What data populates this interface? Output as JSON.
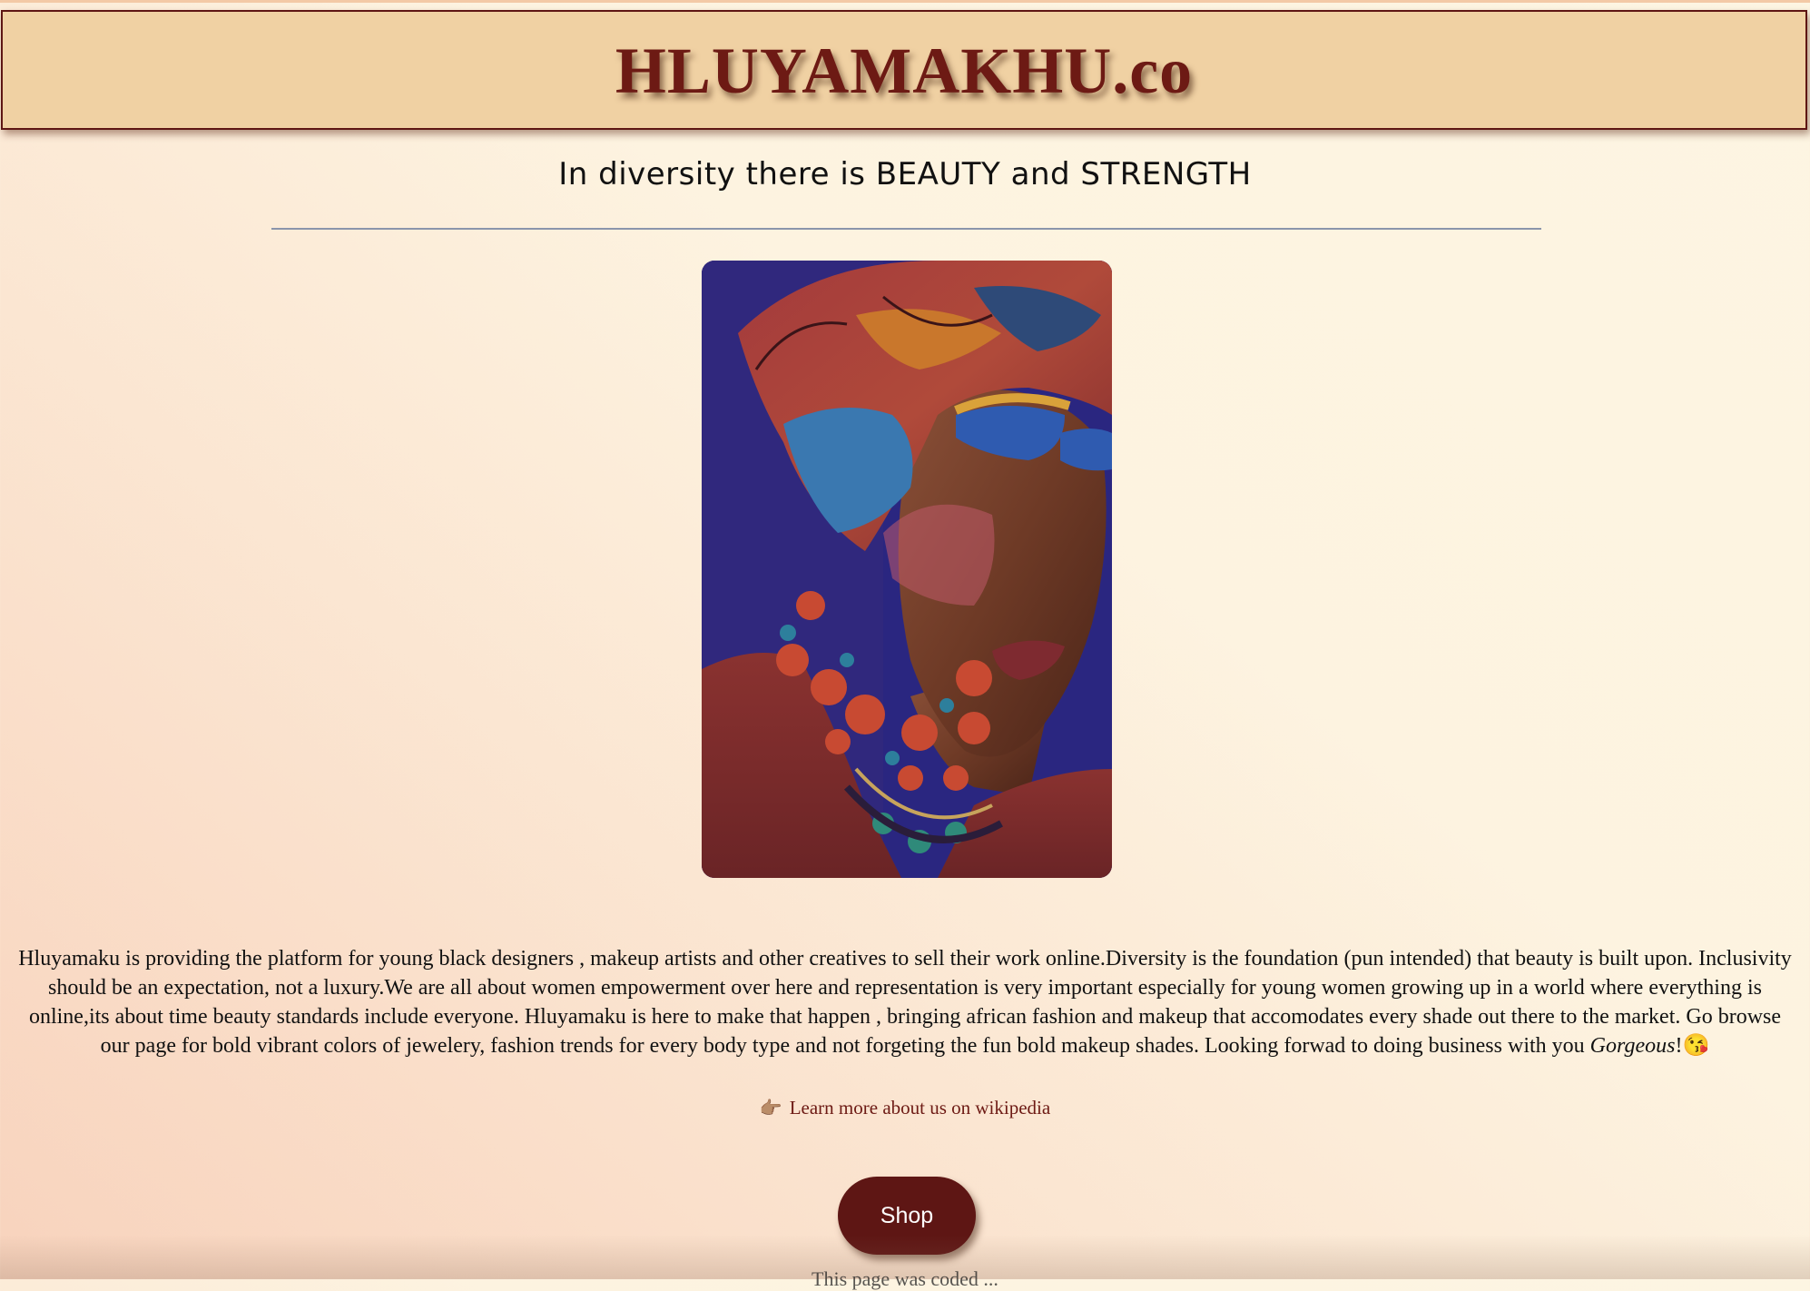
{
  "header": {
    "brand": "HLUYAMAKHU.co",
    "tagline": "In diversity there is BEAUTY and STRENGTH"
  },
  "hero": {
    "image_icon": "portrait-photo"
  },
  "about": {
    "text": "Hluyamaku is providing the platform for young black designers , makeup artists and other creatives to sell their work online.Diversity is the foundation (pun intended) that beauty is built upon. Inclusivity should be an expectation, not a luxury.We are all about women empowerment over here and representation is very important especially for young women growing up in a world where everything is online,its about time beauty standards include everyone. Hluyamaku is here to make that happen , bringing african fashion and makeup that accomodates every shade out there to the market. Go browse our page for bold vibrant colors of jewelery, fashion trends for every body type and not forgeting the fun bold makeup shades. Looking forwad to doing business with you ",
    "closing_word": "Gorgeous",
    "closing_punct": "!",
    "closing_emoji": "😘"
  },
  "links": {
    "wiki_icon": "👉🏽",
    "wiki_label": "Learn more about us on wikipedia"
  },
  "actions": {
    "shop_label": "Shop"
  },
  "footer": {
    "note": "This page was coded ..."
  },
  "colors": {
    "brand": "#6d1a14",
    "header_bg": "#f0d1a3",
    "button_bg": "#5e1614"
  }
}
